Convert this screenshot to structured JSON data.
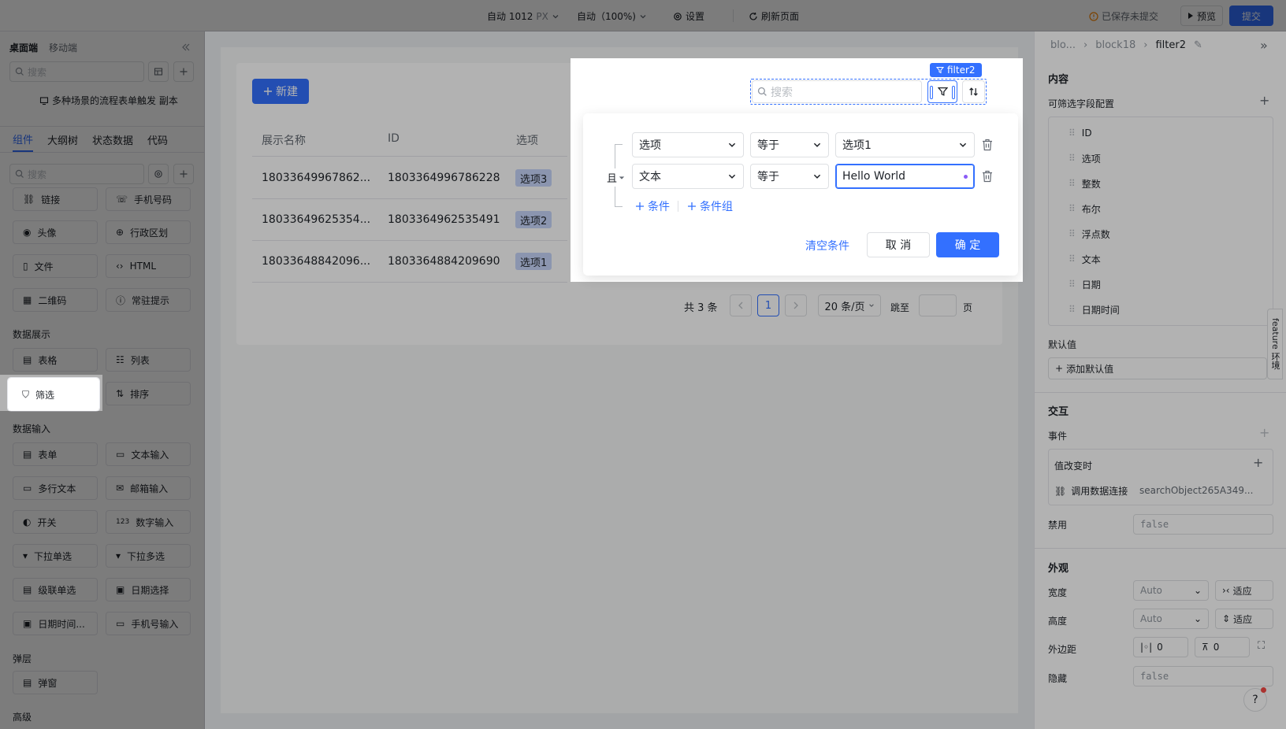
{
  "topbar": {
    "width_label": "自动 1012",
    "width_unit": "PX",
    "zoom_label": "自动（100%)",
    "settings_label": "设置",
    "refresh_label": "刷新页面",
    "unsaved_label": "已保存未提交",
    "preview_label": "预览",
    "submit_label": "提交"
  },
  "left_panel": {
    "tabs": [
      "桌面端",
      "移动端"
    ],
    "search_placeholder": "搜索",
    "flow_note": "多种场景的流程表单触发 副本",
    "component_tabs": [
      "组件",
      "大纲树",
      "状态数据",
      "代码"
    ],
    "component_search_placeholder": "搜索",
    "items_top": [
      {
        "label": "链接",
        "icon": "link-icon"
      },
      {
        "label": "手机号码",
        "icon": "phone-icon"
      },
      {
        "label": "头像",
        "icon": "avatar-icon"
      },
      {
        "label": "行政区划",
        "icon": "region-icon"
      },
      {
        "label": "文件",
        "icon": "file-icon"
      },
      {
        "label": "HTML",
        "icon": "code-icon"
      },
      {
        "label": "二维码",
        "icon": "qrcode-icon"
      },
      {
        "label": "常驻提示",
        "icon": "info-icon"
      }
    ],
    "section_data_display": "数据展示",
    "items_display": [
      {
        "label": "表格",
        "icon": "table-icon"
      },
      {
        "label": "列表",
        "icon": "list-icon"
      },
      {
        "label": "筛选",
        "icon": "filter-icon"
      },
      {
        "label": "排序",
        "icon": "sort-icon"
      }
    ],
    "section_data_input": "数据输入",
    "items_input": [
      {
        "label": "表单",
        "icon": "form-icon"
      },
      {
        "label": "文本输入",
        "icon": "text-input-icon"
      },
      {
        "label": "多行文本",
        "icon": "textarea-icon"
      },
      {
        "label": "邮箱输入",
        "icon": "mail-icon"
      },
      {
        "label": "开关",
        "icon": "switch-icon"
      },
      {
        "label": "数字输入",
        "icon": "number-icon"
      },
      {
        "label": "下拉单选",
        "icon": "select-icon"
      },
      {
        "label": "下拉多选",
        "icon": "multiselect-icon"
      },
      {
        "label": "级联单选",
        "icon": "cascader-icon"
      },
      {
        "label": "日期选择",
        "icon": "calendar-icon"
      },
      {
        "label": "日期时间...",
        "icon": "datetime-icon"
      },
      {
        "label": "手机号输入",
        "icon": "phone-input-icon"
      }
    ],
    "section_layer": "弹层",
    "items_layer": [
      {
        "label": "弹窗",
        "icon": "modal-icon"
      }
    ],
    "section_advanced": "高级"
  },
  "canvas": {
    "new_button": "新建",
    "columns": [
      "展示名称",
      "ID",
      "选项"
    ],
    "rows": [
      {
        "name": "18033649967862...",
        "id": "1803364996786228",
        "option": "选项3"
      },
      {
        "name": "18033649625354...",
        "id": "1803364962535491",
        "option": "选项2"
      },
      {
        "name": "18033648842096...",
        "id": "1803364884209690",
        "option": "选项1"
      }
    ],
    "pagination": {
      "total": "共 3 条",
      "current_page": "1",
      "page_size": "20 条/页",
      "jump_label": "跳至",
      "page_suffix": "页"
    },
    "toolbar": {
      "component_tag": "filter2",
      "search_placeholder": "搜索"
    }
  },
  "filter_popup": {
    "logic": "且",
    "conditions": [
      {
        "field": "选项",
        "operator": "等于",
        "value": "选项1"
      },
      {
        "field": "文本",
        "operator": "等于",
        "value": "Hello World"
      }
    ],
    "add_condition": "条件",
    "add_group": "条件组",
    "clear": "清空条件",
    "cancel": "取 消",
    "confirm": "确 定"
  },
  "right_panel": {
    "breadcrumb": [
      "blo...",
      "block18",
      "filter2"
    ],
    "content_title": "内容",
    "filterable_fields_title": "可筛选字段配置",
    "fields": [
      "ID",
      "选项",
      "整数",
      "布尔",
      "浮点数",
      "文本",
      "日期",
      "日期时间"
    ],
    "default_title": "默认值",
    "add_default": "添加默认值",
    "feature_tab": "feature 环境",
    "interaction_title": "交互",
    "events_label": "事件",
    "on_change": "值改变时",
    "call_data": "调用数据连接",
    "call_target": "searchObject265A349...",
    "disabled_label": "禁用",
    "disabled_value": "false",
    "appearance_title": "外观",
    "width_label": "宽度",
    "width_value": "Auto",
    "width_mode": "适应",
    "height_label": "高度",
    "height_value": "Auto",
    "height_mode": "适应",
    "margin_label": "外边距",
    "margin_x": "0",
    "margin_y": "0",
    "hidden_label": "隐藏",
    "hidden_value": "false"
  },
  "colors": {
    "accent": "#3370ff",
    "mask": "rgba(0,0,0,0.30)"
  }
}
